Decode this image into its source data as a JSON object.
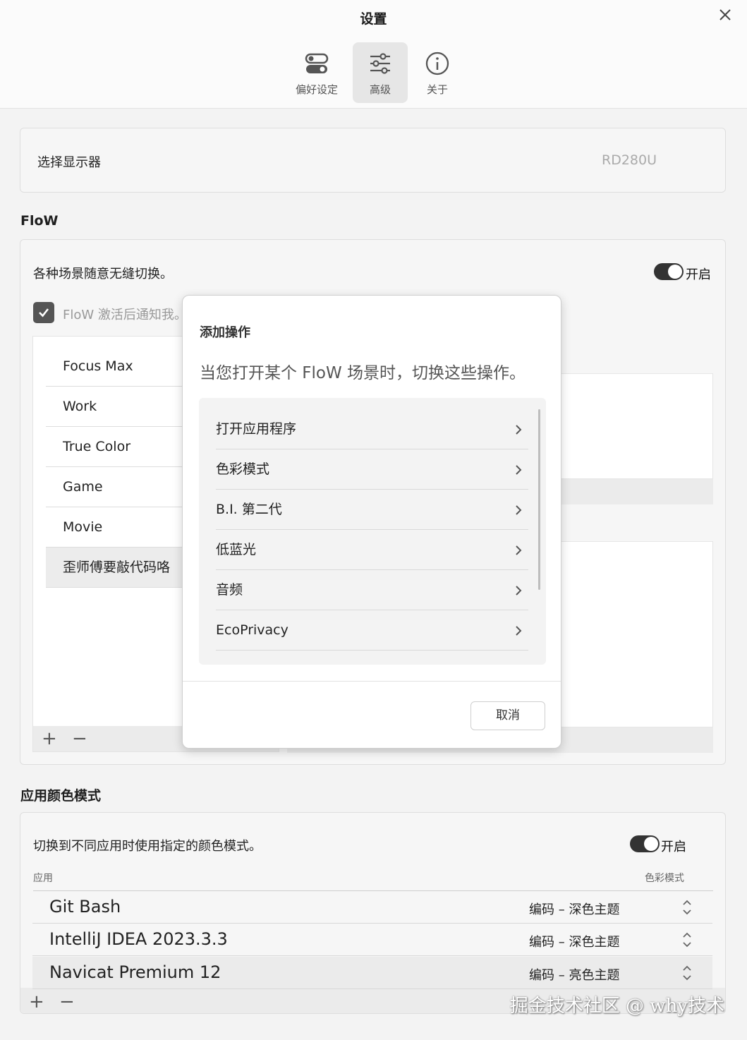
{
  "window": {
    "title": "设置"
  },
  "tabs": [
    {
      "label": "偏好设定",
      "icon": "toggles-icon",
      "active": false
    },
    {
      "label": "高级",
      "icon": "sliders-icon",
      "active": true
    },
    {
      "label": "关于",
      "icon": "info-icon",
      "active": false
    }
  ],
  "display": {
    "label": "选择显示器",
    "value": "RD280U"
  },
  "flow": {
    "section_title": "FloW",
    "description": "各种场景随意无缝切换。",
    "toggle_label": "开启",
    "toggle_on": true,
    "notify_label": "FloW 激活后通知我。",
    "notify_checked": true,
    "scenes": [
      "Focus Max",
      "Work",
      "True Color",
      "Game",
      "Movie",
      "歪师傅要敲代码咯"
    ],
    "selected_scene": 5,
    "add": "+",
    "remove": "−"
  },
  "modal": {
    "title": "添加操作",
    "description": "当您打开某个 FloW 场景时，切换这些操作。",
    "actions": [
      "打开应用程序",
      "色彩模式",
      "B.I. 第二代",
      "低蓝光",
      "音频",
      "EcoPrivacy"
    ],
    "cancel_label": "取消"
  },
  "app_color": {
    "section_title": "应用颜色模式",
    "description": "切换到不同应用时使用指定的颜色模式。",
    "toggle_label": "开启",
    "toggle_on": true,
    "col_app": "应用",
    "col_mode": "色彩模式",
    "rows": [
      {
        "app": "Git Bash",
        "mode": "编码 – 深色主题"
      },
      {
        "app": "IntelliJ IDEA 2023.3.3",
        "mode": "编码 – 深色主题"
      },
      {
        "app": "Navicat Premium 12",
        "mode": "编码 – 亮色主题"
      }
    ],
    "selected_row": 2,
    "add": "+",
    "remove": "−"
  },
  "watermark": "掘金技术社区 @ why技术"
}
